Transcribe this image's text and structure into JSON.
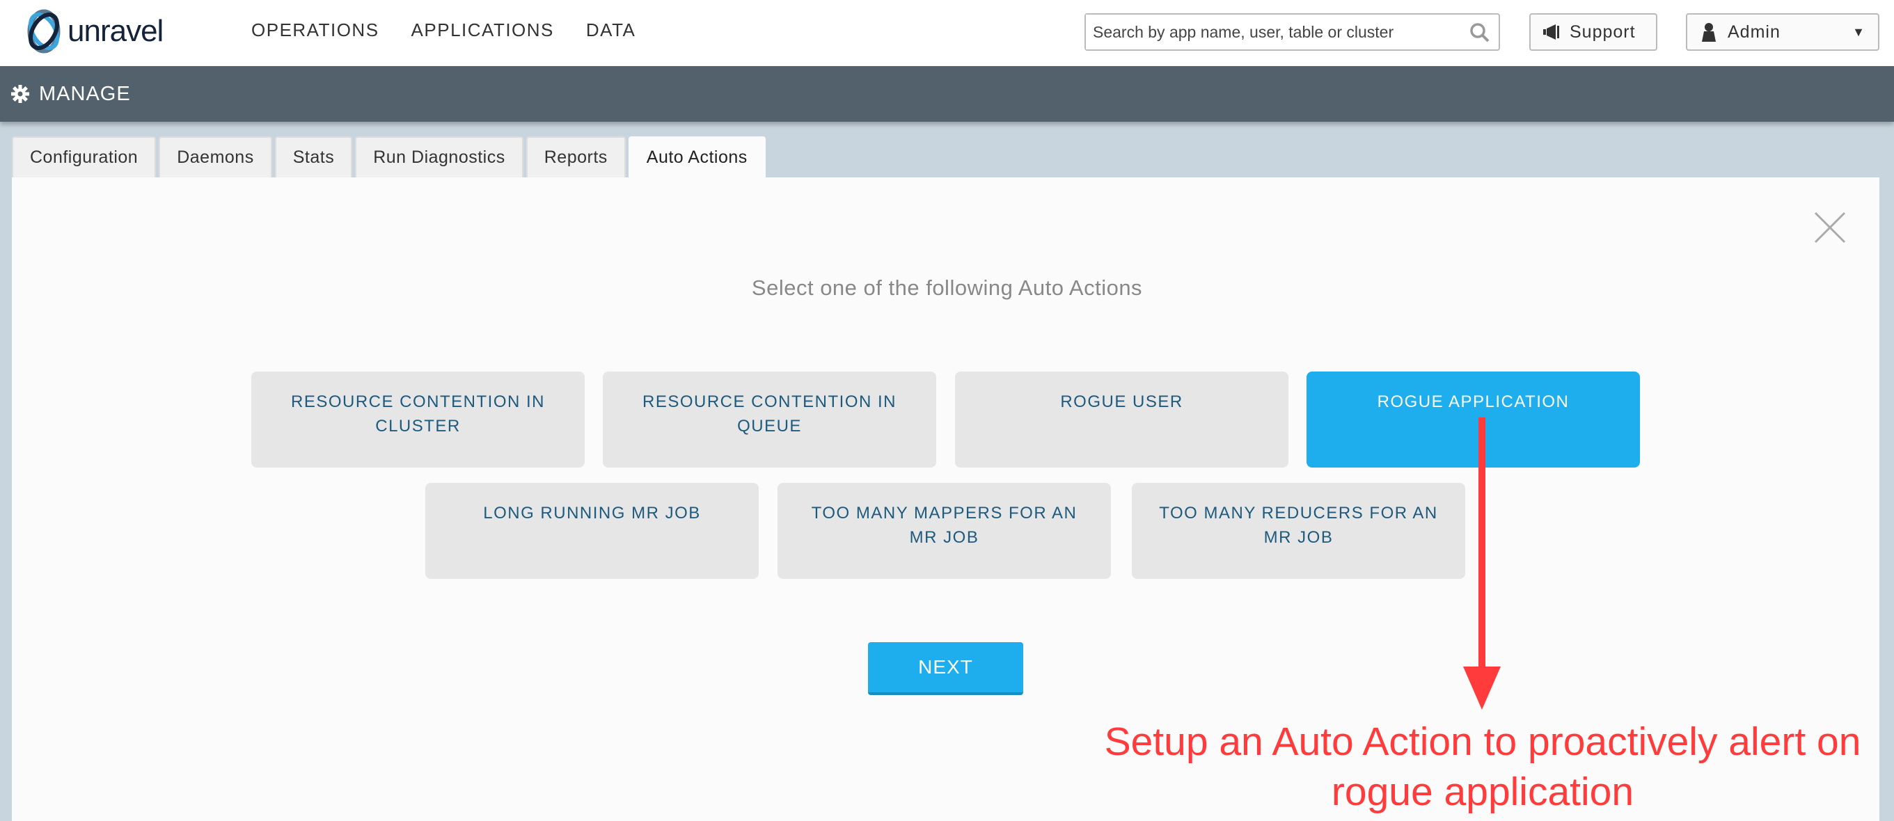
{
  "header": {
    "logo_text": "unravel",
    "nav": [
      "OPERATIONS",
      "APPLICATIONS",
      "DATA"
    ],
    "search_placeholder": "Search by app name, user, table or cluster",
    "support_label": "Support",
    "user_label": "Admin"
  },
  "section": {
    "title": "MANAGE",
    "icon": "gear-icon"
  },
  "tabs": [
    "Configuration",
    "Daemons",
    "Stats",
    "Run Diagnostics",
    "Reports",
    "Auto Actions"
  ],
  "active_tab": "Auto Actions",
  "main": {
    "title": "Select one of the following Auto Actions",
    "options": [
      "RESOURCE CONTENTION IN CLUSTER",
      "RESOURCE CONTENTION IN QUEUE",
      "ROGUE USER",
      "ROGUE APPLICATION",
      "LONG RUNNING MR JOB",
      "TOO MANY MAPPERS FOR AN MR JOB",
      "TOO MANY REDUCERS FOR AN MR JOB"
    ],
    "selected": "ROGUE APPLICATION",
    "next_label": "NEXT"
  },
  "annotation": {
    "line1": "Setup an Auto Action to proactively alert on",
    "line2": "rogue application"
  },
  "colors": {
    "accent": "#1eaeee",
    "header_bar": "#53616c",
    "annotation": "#ff3b3b",
    "option_text": "#1d5a7d"
  }
}
